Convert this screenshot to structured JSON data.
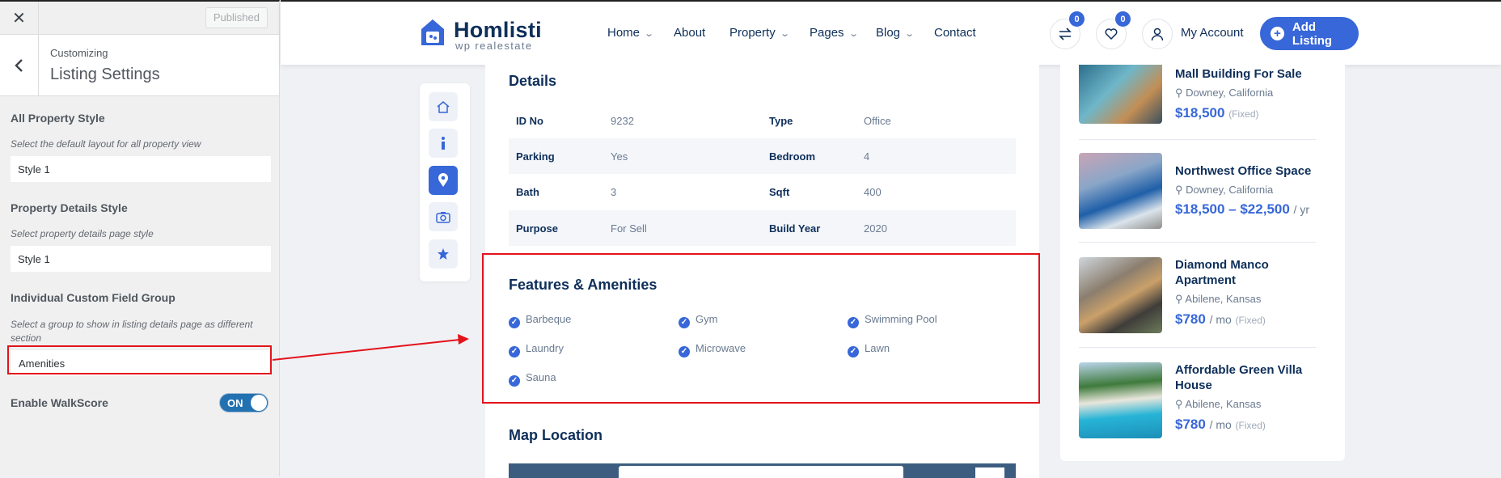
{
  "customizer": {
    "close_glyph": "✕",
    "published_label": "Published",
    "back_glyph": "‹",
    "breadcrumb": "Customizing",
    "section_title": "Listing Settings",
    "controls": [
      {
        "title": "All Property Style",
        "desc": "Select the default layout for all property view",
        "value": "Style 1"
      },
      {
        "title": "Property Details Style",
        "desc": "Select property details page style",
        "value": "Style 1"
      },
      {
        "title": "Individual Custom Field Group",
        "desc": "Select a group to show in listing details page as different section",
        "value": "Amenities"
      }
    ],
    "walkscore_label": "Enable WalkScore",
    "walkscore_toggle": "ON"
  },
  "header": {
    "logo_title": "Homlisti",
    "logo_sub": "wp realestate",
    "nav": [
      "Home",
      "About",
      "Property",
      "Pages",
      "Blog",
      "Contact"
    ],
    "compare_count": "0",
    "wishlist_count": "0",
    "account_label": "My Account",
    "add_listing_label": "Add Listing"
  },
  "details": {
    "heading": "Details",
    "rows": [
      {
        "k1": "ID No",
        "v1": "9232",
        "k2": "Type",
        "v2": "Office"
      },
      {
        "k1": "Parking",
        "v1": "Yes",
        "k2": "Bedroom",
        "v2": "4"
      },
      {
        "k1": "Bath",
        "v1": "3",
        "k2": "Sqft",
        "v2": "400"
      },
      {
        "k1": "Purpose",
        "v1": "For Sell",
        "k2": "Build Year",
        "v2": "2020"
      }
    ]
  },
  "features": {
    "heading": "Features & Amenities",
    "items": [
      "Barbeque",
      "Gym",
      "Swimming Pool",
      "Laundry",
      "Microwave",
      "Lawn",
      "Sauna"
    ]
  },
  "map": {
    "heading": "Map Location"
  },
  "listings": [
    {
      "title": "Mall Building For Sale",
      "location": "Downey, California",
      "price": "$18,500",
      "unit": "",
      "note": "(Fixed)"
    },
    {
      "title": "Northwest Office Space",
      "location": "Downey, California",
      "price": "$18,500 – $22,500",
      "unit": "/ yr",
      "note": ""
    },
    {
      "title": "Diamond Manco Apartment",
      "location": "Abilene, Kansas",
      "price": "$780",
      "unit": "/ mo",
      "note": "(Fixed)"
    },
    {
      "title": "Affordable Green Villa House",
      "location": "Abilene, Kansas",
      "price": "$780",
      "unit": "/ mo",
      "note": "(Fixed)"
    }
  ],
  "colors": {
    "accent": "#3767d8",
    "navy": "#0e2f5a",
    "annotation": "#e3131b"
  }
}
